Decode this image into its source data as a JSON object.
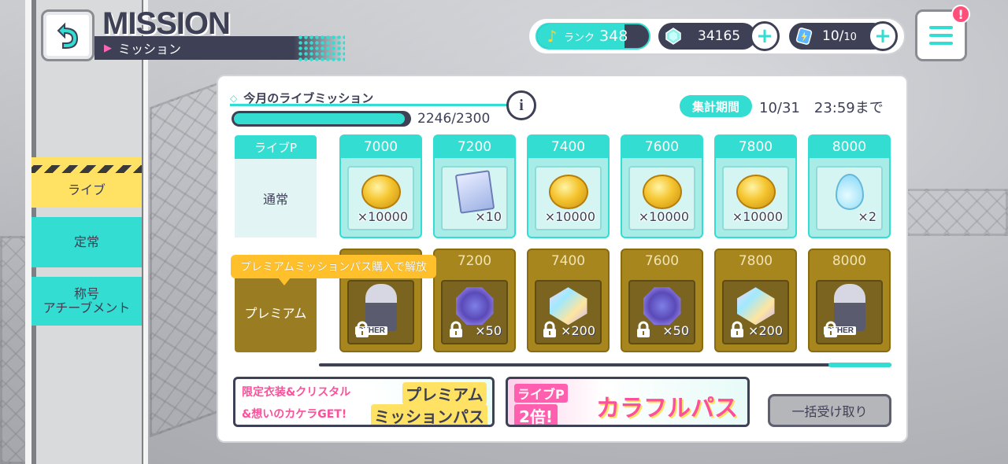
{
  "header": {
    "title": "MISSION",
    "subtitle": "ミッション"
  },
  "sidebar": {
    "items": [
      {
        "label": "ライブ",
        "active": true
      },
      {
        "label": "定常",
        "active": false
      },
      {
        "label": "称号\nアチーブメント",
        "active": false
      }
    ]
  },
  "topbar": {
    "rank_label": "ランク",
    "rank_value": "348",
    "rank_progress": 0.78,
    "crystal_value": "34165",
    "stamina_value": "10/",
    "stamina_max": "10",
    "plus": "+",
    "menu_badge": "!"
  },
  "panel": {
    "title": "今月のライブミッション",
    "progress_text": "2246/2300",
    "progress_fraction": 0.976,
    "info": "i",
    "period_badge": "集計期間",
    "period_value": "10/31　23:59まで"
  },
  "rows": {
    "header_label": "ライブP",
    "normal_label": "通常",
    "premium_label": "プレミアム"
  },
  "normal_rewards": [
    {
      "score": "7000",
      "item": "coin",
      "qty": "×10000"
    },
    {
      "score": "7200",
      "item": "skill-card",
      "qty": "×10"
    },
    {
      "score": "7400",
      "item": "coin",
      "qty": "×10000"
    },
    {
      "score": "7600",
      "item": "coin",
      "qty": "×10000"
    },
    {
      "score": "7800",
      "item": "coin",
      "qty": "×10000"
    },
    {
      "score": "8000",
      "item": "drop",
      "qty": "×2"
    }
  ],
  "premium_rewards": [
    {
      "score": "",
      "item": "character",
      "qty": "",
      "tag": "OTHER"
    },
    {
      "score": "7200",
      "item": "octagon-gem",
      "qty": "×50"
    },
    {
      "score": "7400",
      "item": "crystal",
      "qty": "×200"
    },
    {
      "score": "7600",
      "item": "octagon-gem",
      "qty": "×50"
    },
    {
      "score": "7800",
      "item": "crystal",
      "qty": "×200"
    },
    {
      "score": "8000",
      "item": "character",
      "qty": "",
      "tag": "OTHER"
    }
  ],
  "tooltip": "プレミアムミッションパス購入で解放",
  "banners": {
    "premium": {
      "line1": "限定衣装&クリスタル",
      "line2": "&想いのカケラGET!",
      "title1": "プレミアム",
      "title2": "ミッションパス"
    },
    "colorful": {
      "line1": "ライブP",
      "line2": "2倍!",
      "title": "カラフルパス"
    }
  },
  "claim_button": "一括受け取り",
  "colors": {
    "accent": "#33ddd2",
    "navy": "#3e4055",
    "yellow": "#ffe263",
    "premium_gold": "#a8861e",
    "pink": "#ff4e9a"
  }
}
